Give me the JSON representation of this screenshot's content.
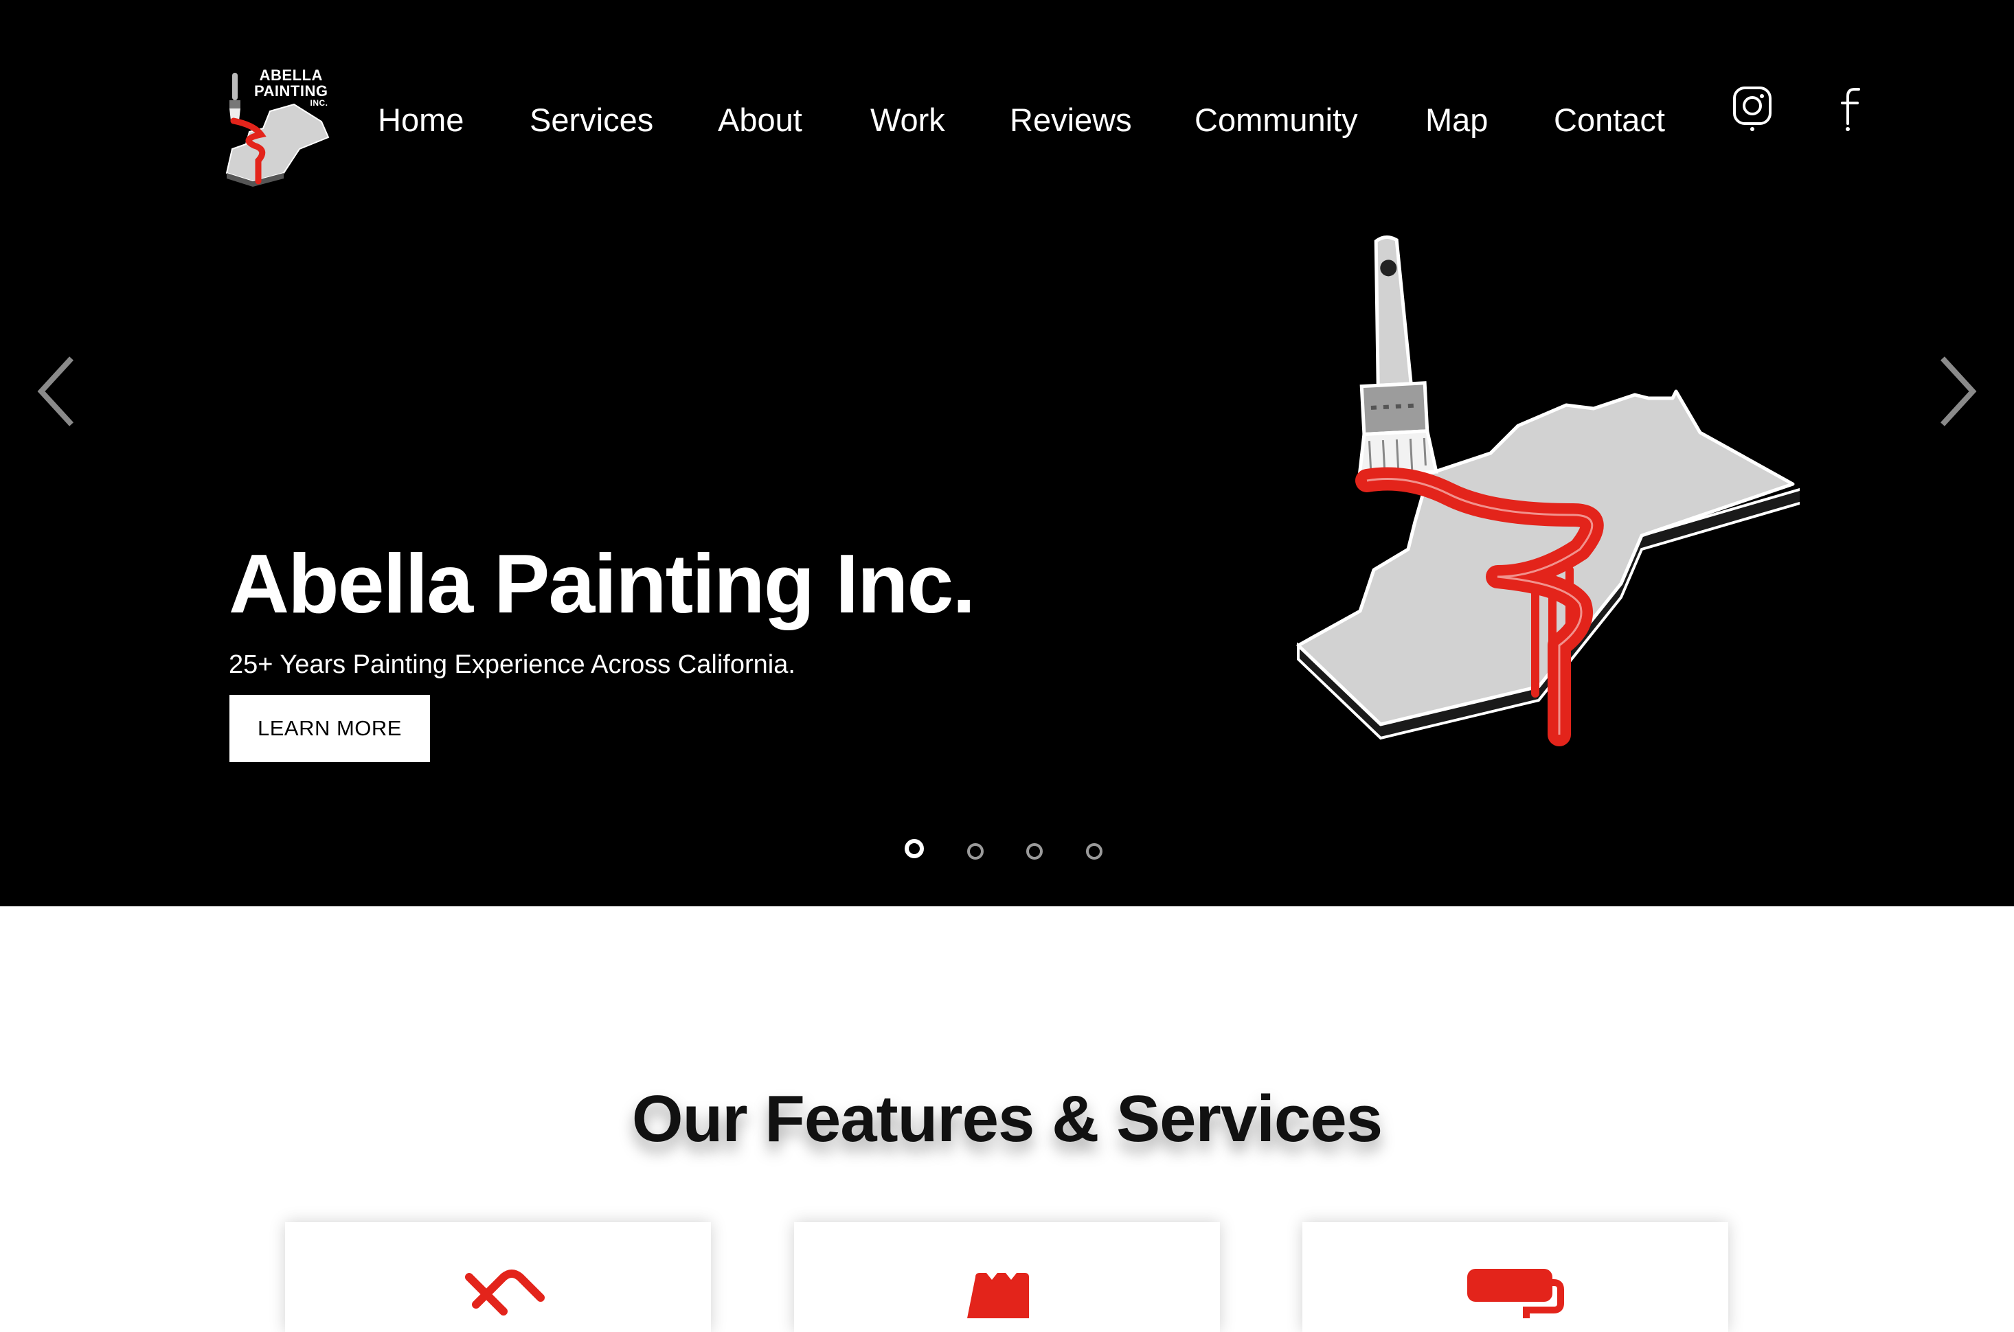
{
  "brand": {
    "logo_line1": "ABELLA",
    "logo_line2": "PAINTING",
    "logo_line3": "INC."
  },
  "nav": {
    "items": [
      {
        "label": "Home"
      },
      {
        "label": "Services"
      },
      {
        "label": "About"
      },
      {
        "label": "Work"
      },
      {
        "label": "Reviews"
      },
      {
        "label": "Community"
      },
      {
        "label": "Map"
      },
      {
        "label": "Contact"
      }
    ],
    "social": [
      {
        "icon": "instagram-icon"
      },
      {
        "icon": "facebook-icon"
      }
    ]
  },
  "hero": {
    "slides_total": 4,
    "active_slide": 1,
    "title": "Abella Painting Inc.",
    "subtitle": "25+ Years Painting Experience Across California.",
    "button_label": "LEARN MORE",
    "prev_icon": "chevron-left-icon",
    "next_icon": "chevron-right-icon"
  },
  "features": {
    "title": "Our Features & Services",
    "cards": [
      {
        "icon": "paint-scraper-icon"
      },
      {
        "icon": "paint-bucket-icon"
      },
      {
        "icon": "paint-roller-icon"
      }
    ]
  },
  "colors": {
    "accent": "#e3241b",
    "hero_bg": "#000000",
    "text_light": "#ffffff",
    "map_gray": "#d2d2d2"
  }
}
